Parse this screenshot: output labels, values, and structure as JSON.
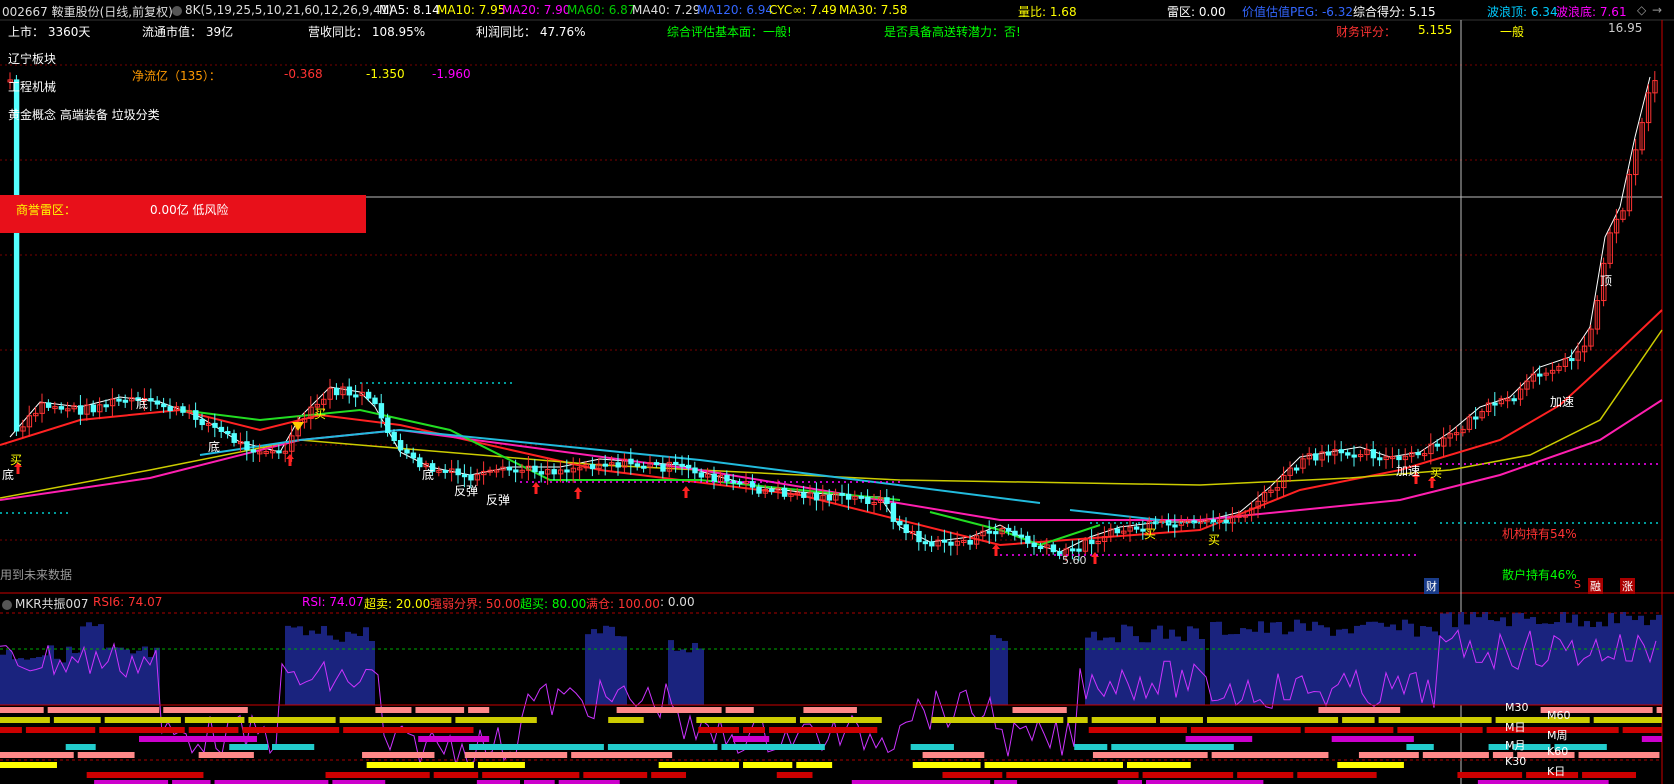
{
  "header": {
    "stock": "002667 鞍重股份(日线,前复权)",
    "indicator": "8K(5,19,25,5,10,21,60,12,26,9,41)",
    "ma5": "MA5: 8.14",
    "ma10": "MA10: 7.95",
    "ma20": "MA20: 7.90",
    "ma60": "MA60: 6.87",
    "ma40": "MA40: 7.29",
    "ma120": "MA120: 6.94",
    "cyc": "CYC∞: 7.49",
    "ma30": "MA30: 7.58",
    "volume_ratio": "量比: 1.68",
    "thunder": "雷区: 0.00",
    "peg": "价值估值PEG: -6.32",
    "score": "综合得分: 5.15",
    "wave_top": "波浪顶: 6.34",
    "wave_bottom": "波浪底: 7.61"
  },
  "info": {
    "listed": "上市：  3360天",
    "market_cap": "流通市值：  39亿",
    "revenue": "营收同比：  108.95%",
    "profit": "利润同比：  47.76%",
    "fundamental": "综合评估基本面：一般!",
    "transfer": "是否具备高送转潜力：否!",
    "finance_label": "财务评分：",
    "finance_value": "5.155",
    "finance_grade": "一般",
    "sector1": "辽宁板块",
    "sector2": "工程机械",
    "sector3": "黄金概念 高端装备 垃圾分类",
    "netflow_label": "净流亿（135）：",
    "netflow1": "-0.368",
    "netflow2": "-1.350",
    "netflow3": "-1.960",
    "goodwill_label": "商誉雷区：",
    "goodwill_value": "0.00亿 低风险",
    "future_data": "用到未来数据"
  },
  "chart_labels": {
    "price_high": "16.95",
    "price_low": "5.60",
    "inst_hold": "机构持有54%",
    "retail_hold": "散户持有46%",
    "fin_tag": "财",
    "tag1": "融",
    "tag2": "涨",
    "tag3": "S",
    "annotations": [
      "买",
      "底",
      "底",
      "底",
      "买",
      "底",
      "反弹",
      "反弹",
      "买",
      "买",
      "加速",
      "买",
      "加速",
      "顶"
    ]
  },
  "sub_indicator": {
    "name": "MKR共振007",
    "rsi6": "RSI6: 74.07",
    "rsi": "RSI: 74.07",
    "oversell": "超卖: 20.00",
    "divide": "强弱分界: 50.00",
    "overbuy": "超买: 80.00",
    "full": "满仓: 100.00",
    "extra": ": 0.00",
    "row_labels_left": [
      "M30",
      "M日",
      "M月",
      "K30"
    ],
    "row_labels_right": [
      "M60",
      "M周",
      "K60",
      "K日"
    ]
  },
  "colors": {
    "ma5": "#ffffff",
    "ma10": "#ffff00",
    "ma20": "#ff00ff",
    "ma60": "#00ff00",
    "ma120": "#3366ff",
    "up": "#ff3333",
    "down": "#54ffff",
    "vol": "#1a237e"
  }
}
